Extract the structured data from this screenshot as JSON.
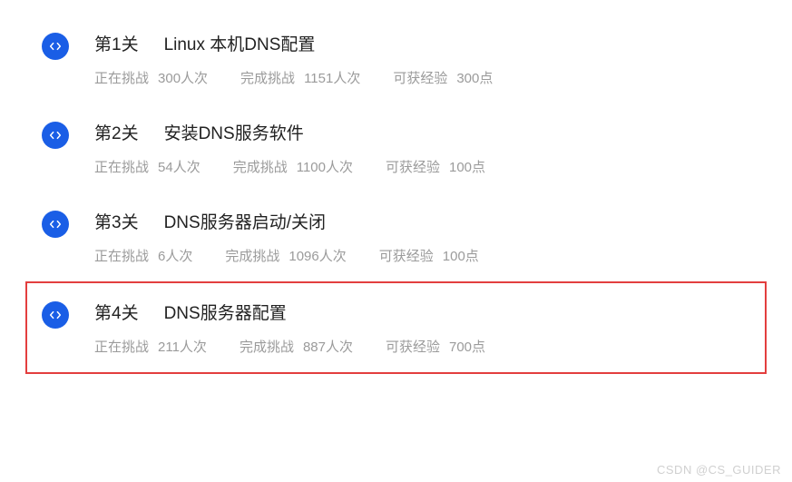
{
  "labels": {
    "in_progress": "正在挑战",
    "completed": "完成挑战",
    "experience": "可获经验"
  },
  "items": [
    {
      "level": "第1关",
      "title": "Linux 本机DNS配置",
      "in_progress": "300人次",
      "completed": "1151人次",
      "experience": "300点",
      "highlighted": false
    },
    {
      "level": "第2关",
      "title": "安装DNS服务软件",
      "in_progress": "54人次",
      "completed": "1100人次",
      "experience": "100点",
      "highlighted": false
    },
    {
      "level": "第3关",
      "title": "DNS服务器启动/关闭",
      "in_progress": "6人次",
      "completed": "1096人次",
      "experience": "100点",
      "highlighted": false
    },
    {
      "level": "第4关",
      "title": "DNS服务器配置",
      "in_progress": "211人次",
      "completed": "887人次",
      "experience": "700点",
      "highlighted": true
    }
  ],
  "watermark": "CSDN @CS_GUIDER"
}
